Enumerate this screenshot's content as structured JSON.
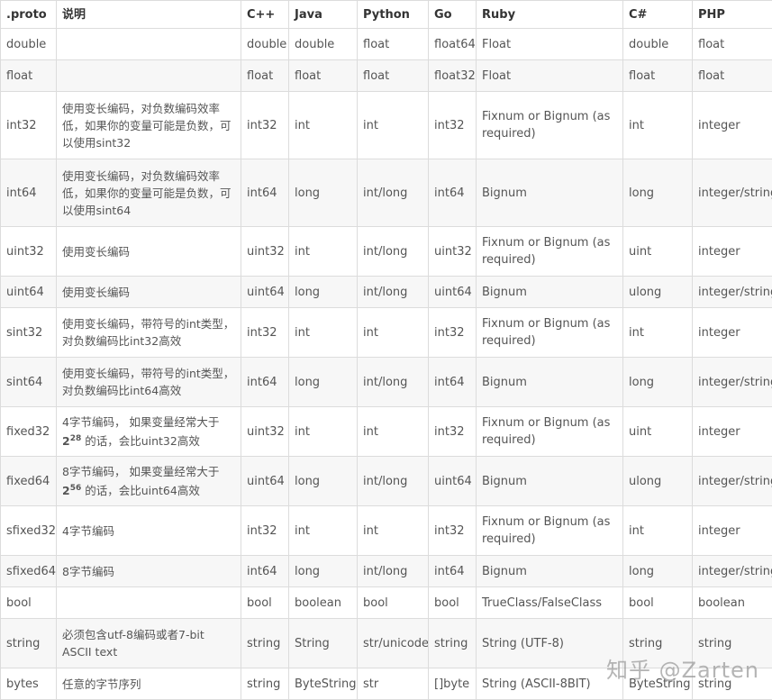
{
  "headers": [
    ".proto",
    "说明",
    "C++",
    "Java",
    "Python",
    "Go",
    "Ruby",
    "C#",
    "PHP"
  ],
  "rows": [
    {
      "proto": "double",
      "desc": "",
      "cpp": "double",
      "java": "double",
      "python": "float",
      "go": "float64",
      "ruby": "Float",
      "csharp": "double",
      "php": "float"
    },
    {
      "proto": "float",
      "desc": "",
      "cpp": "float",
      "java": "float",
      "python": "float",
      "go": "float32",
      "ruby": "Float",
      "csharp": "float",
      "php": "float"
    },
    {
      "proto": "int32",
      "desc": "使用变长编码，对负数编码效率低，如果你的变量可能是负数，可以使用sint32",
      "cpp": "int32",
      "java": "int",
      "python": "int",
      "go": "int32",
      "ruby": "Fixnum or Bignum (as required)",
      "csharp": "int",
      "php": "integer"
    },
    {
      "proto": "int64",
      "desc": "使用变长编码，对负数编码效率低，如果你的变量可能是负数，可以使用sint64",
      "cpp": "int64",
      "java": "long",
      "python": "int/long",
      "go": "int64",
      "ruby": "Bignum",
      "csharp": "long",
      "php": "integer/string"
    },
    {
      "proto": "uint32",
      "desc": "使用变长编码",
      "cpp": "uint32",
      "java": "int",
      "python": "int/long",
      "go": "uint32",
      "ruby": "Fixnum or Bignum (as required)",
      "csharp": "uint",
      "php": "integer"
    },
    {
      "proto": "uint64",
      "desc": "使用变长编码",
      "cpp": "uint64",
      "java": "long",
      "python": "int/long",
      "go": "uint64",
      "ruby": "Bignum",
      "csharp": "ulong",
      "php": "integer/string"
    },
    {
      "proto": "sint32",
      "desc": "使用变长编码，带符号的int类型，对负数编码比int32高效",
      "cpp": "int32",
      "java": "int",
      "python": "int",
      "go": "int32",
      "ruby": "Fixnum or Bignum (as required)",
      "csharp": "int",
      "php": "integer"
    },
    {
      "proto": "sint64",
      "desc": "使用变长编码，带符号的int类型，对负数编码比int64高效",
      "cpp": "int64",
      "java": "long",
      "python": "int/long",
      "go": "int64",
      "ruby": "Bignum",
      "csharp": "long",
      "php": "integer/string"
    },
    {
      "proto": "fixed32",
      "desc_pre": "4字节编码， 如果变量经常大于",
      "desc_base": "2",
      "desc_exp": "28",
      "desc_post": " 的话，会比uint32高效",
      "cpp": "uint32",
      "java": "int",
      "python": "int",
      "go": "int32",
      "ruby": "Fixnum or Bignum (as required)",
      "csharp": "uint",
      "php": "integer"
    },
    {
      "proto": "fixed64",
      "desc_pre": "8字节编码， 如果变量经常大于",
      "desc_base": "2",
      "desc_exp": "56",
      "desc_post": " 的话，会比uint64高效",
      "cpp": "uint64",
      "java": "long",
      "python": "int/long",
      "go": "uint64",
      "ruby": "Bignum",
      "csharp": "ulong",
      "php": "integer/string"
    },
    {
      "proto": "sfixed32",
      "desc": "4字节编码",
      "cpp": "int32",
      "java": "int",
      "python": "int",
      "go": "int32",
      "ruby": "Fixnum or Bignum (as required)",
      "csharp": "int",
      "php": "integer"
    },
    {
      "proto": "sfixed64",
      "desc": "8字节编码",
      "cpp": "int64",
      "java": "long",
      "python": "int/long",
      "go": "int64",
      "ruby": "Bignum",
      "csharp": "long",
      "php": "integer/string"
    },
    {
      "proto": "bool",
      "desc": "",
      "cpp": "bool",
      "java": "boolean",
      "python": "bool",
      "go": "bool",
      "ruby": "TrueClass/FalseClass",
      "csharp": "bool",
      "php": "boolean"
    },
    {
      "proto": "string",
      "desc": "必须包含utf-8编码或者7-bit ASCII text",
      "cpp": "string",
      "java": "String",
      "python": "str/unicode",
      "go": "string",
      "ruby": "String (UTF-8)",
      "csharp": "string",
      "php": "string"
    },
    {
      "proto": "bytes",
      "desc": "任意的字节序列",
      "cpp": "string",
      "java": "ByteString",
      "python": "str",
      "go": "[]byte",
      "ruby": "String (ASCII-8BIT)",
      "csharp": "ByteString",
      "php": "string"
    }
  ],
  "watermark": "知乎 @Zarten"
}
